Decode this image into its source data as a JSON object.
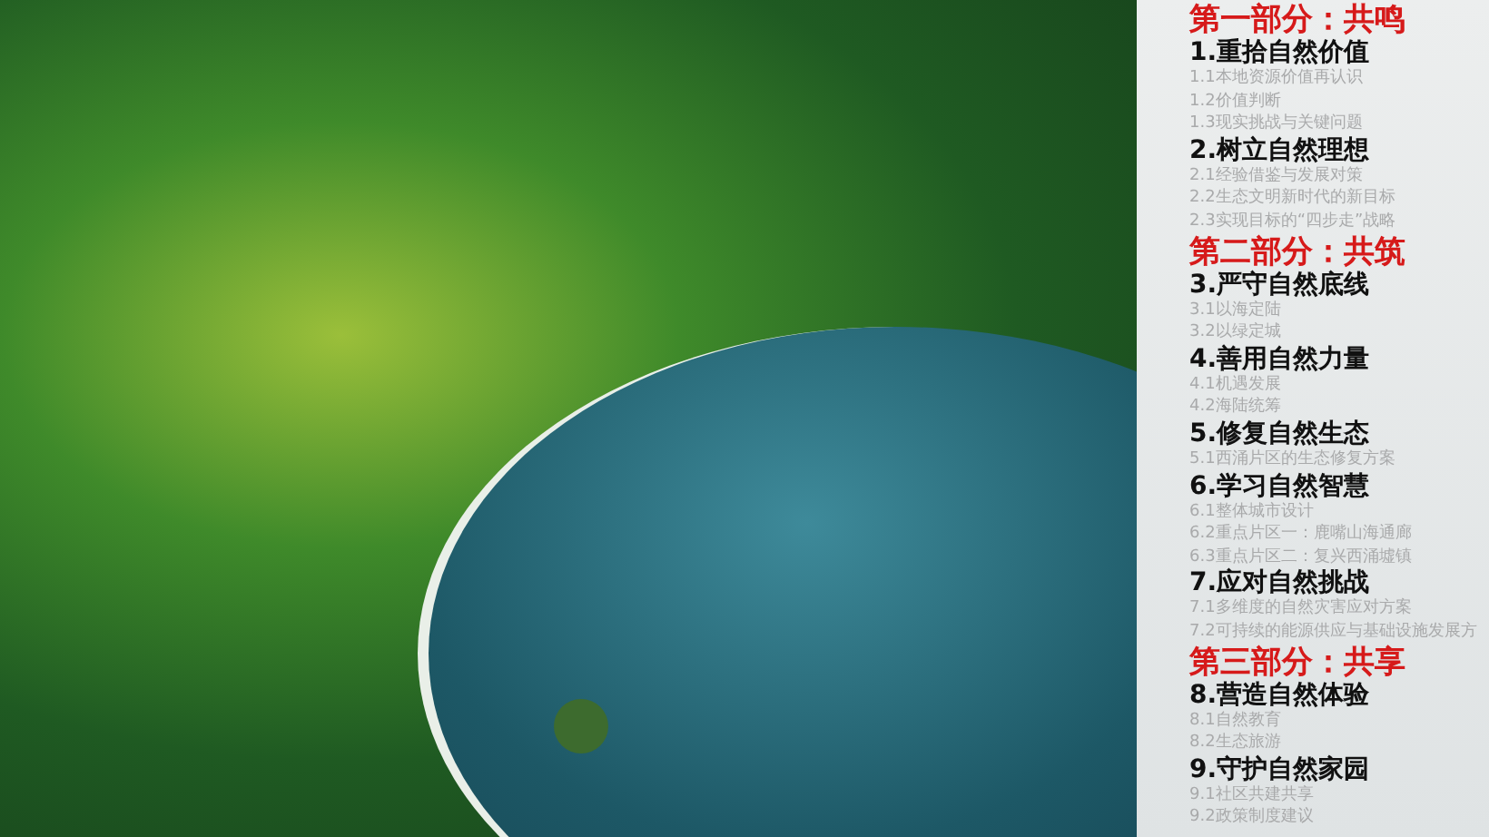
{
  "sections": [
    {
      "heading": "第一部分：共鸣",
      "chapters": [
        {
          "title": "1.重拾自然价值",
          "items": [
            "1.1本地资源价值再认识",
            "1.2价值判断",
            "1.3现实挑战与关键问题"
          ]
        },
        {
          "title": "2.树立自然理想",
          "items": [
            "2.1经验借鉴与发展对策",
            "2.2生态文明新时代的新目标",
            "2.3实现目标的“四步走”战略"
          ]
        }
      ]
    },
    {
      "heading": "第二部分：共筑",
      "chapters": [
        {
          "title": "3.严守自然底线",
          "items": [
            "3.1以海定陆",
            "3.2以绿定城"
          ]
        },
        {
          "title": "4.善用自然力量",
          "items": [
            "4.1机遇发展",
            "4.2海陆统筹"
          ]
        },
        {
          "title": "5.修复自然生态",
          "items": [
            "5.1西涌片区的生态修复方案"
          ]
        },
        {
          "title": "6.学习自然智慧",
          "items": [
            "6.1整体城市设计",
            "6.2重点片区一：鹿嘴山海通廊",
            "6.3重点片区二：复兴西涌墟镇"
          ]
        },
        {
          "title": "7.应对自然挑战",
          "items": [
            "7.1多维度的自然灾害应对方案",
            "7.2可持续的能源供应与基础设施发展方"
          ]
        }
      ]
    },
    {
      "heading": "第三部分：共享",
      "chapters": [
        {
          "title": "8.营造自然体验",
          "items": [
            "8.1自然教育",
            "8.2生态旅游"
          ]
        },
        {
          "title": "9.守护自然家园",
          "items": [
            "9.1社区共建共享",
            "9.2政策制度建议"
          ]
        }
      ]
    }
  ]
}
